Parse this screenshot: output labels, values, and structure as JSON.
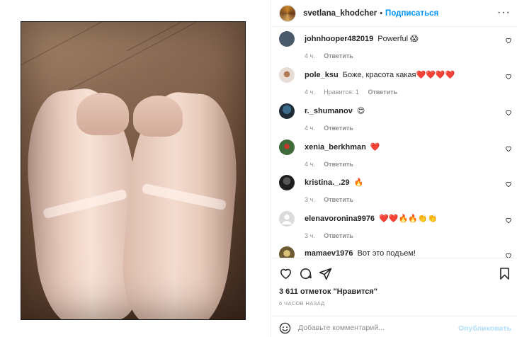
{
  "header": {
    "username": "svetlana_khodcher",
    "separator": "•",
    "follow_label": "Подписаться",
    "more_label": "···"
  },
  "comments": [
    {
      "username": "johnhooper482019",
      "text": "Powerful 😱",
      "time": "4 ч.",
      "likes": "",
      "reply": "Ответить",
      "avatar_color": "#4a5a6a"
    },
    {
      "username": "pole_ksu",
      "text": "Боже, красота какая❤️❤️❤️❤️",
      "time": "4 ч.",
      "likes": "Нравится: 1",
      "reply": "Ответить",
      "avatar_color": "#d8cfc8"
    },
    {
      "username": "r._shumanov",
      "text": "😍",
      "time": "4 ч.",
      "likes": "",
      "reply": "Ответить",
      "avatar_color": "#2c3e50"
    },
    {
      "username": "xenia_berkhman",
      "text": "❤️",
      "time": "4 ч.",
      "likes": "",
      "reply": "Ответить",
      "avatar_color": "#3f6a3a"
    },
    {
      "username": "kristina._.29",
      "text": "🔥",
      "time": "3 ч.",
      "likes": "",
      "reply": "Ответить",
      "avatar_color": "#2a2a2a"
    },
    {
      "username": "elenavoronina9976",
      "text": "❤️❤️🔥🔥👏👏",
      "time": "3 ч.",
      "likes": "",
      "reply": "Ответить",
      "avatar_color": "#dbdbdb"
    },
    {
      "username": "mamaev1976",
      "text": "Вот это подъем!",
      "time": "",
      "likes": "",
      "reply": "",
      "avatar_color": "#8a7a4a"
    }
  ],
  "actions": {
    "like_icon": "heart-outline-icon",
    "comment_icon": "comment-icon",
    "share_icon": "paper-plane-icon",
    "save_icon": "bookmark-icon"
  },
  "likes_text": "3 611 отметок \"Нравится\"",
  "time_ago": "6 часов назад",
  "comment_box": {
    "placeholder": "Добавьте комментарий...",
    "post_label": "Опубликовать"
  },
  "colors": {
    "accent": "#0095f6",
    "post_disabled": "#b2dffc",
    "muted": "#8e8e8e",
    "text": "#262626"
  }
}
